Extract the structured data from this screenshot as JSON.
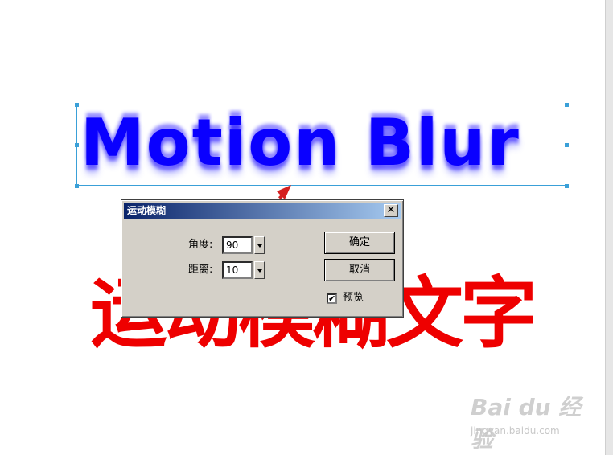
{
  "canvas": {
    "blur_text": "Motion Blur",
    "red_text": "运动模糊文字",
    "blur_color": "#0a00ff",
    "red_color": "#ee0000",
    "selection_color": "#3aa0d8"
  },
  "dialog": {
    "title": "运动模糊",
    "close_label": "✕",
    "angle_label": "角度:",
    "angle_value": "90",
    "distance_label": "距离:",
    "distance_value": "10",
    "ok_label": "确定",
    "cancel_label": "取消",
    "preview_label": "预览",
    "preview_checked": true,
    "preview_mark": "✔"
  },
  "annotation": {
    "arrow_color": "#d42020"
  },
  "watermark": {
    "logo": "Bai du 经验",
    "url": "jingyan.baidu.com"
  }
}
